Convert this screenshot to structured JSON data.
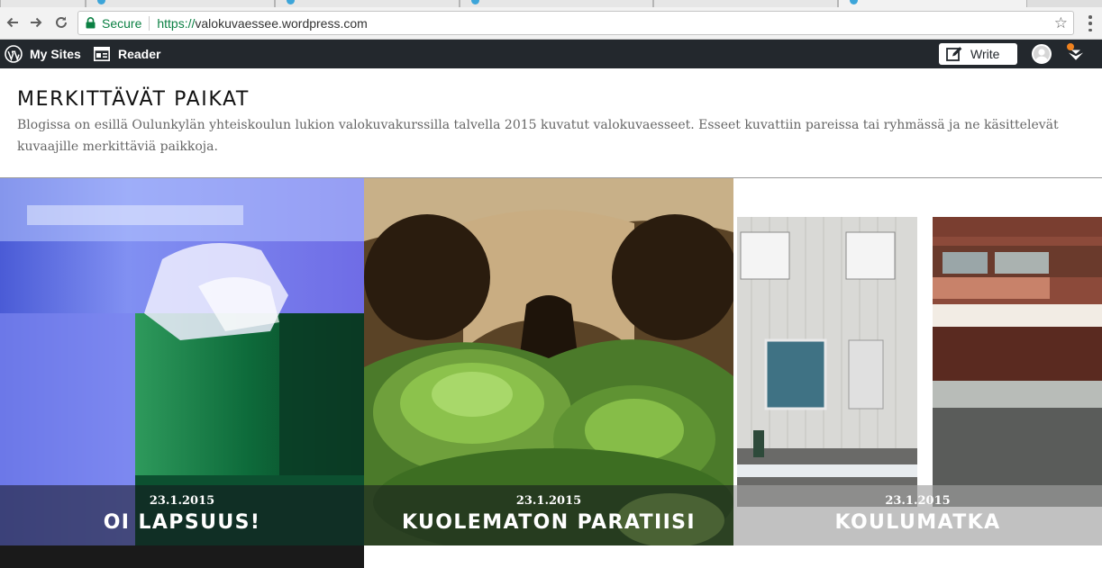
{
  "browser": {
    "secure_label": "Secure",
    "url_scheme": "https://",
    "url_host": "valokuvaessee.wordpress.com",
    "icons": [
      "back-arrow-icon",
      "forward-arrow-icon",
      "reload-icon",
      "lock-icon",
      "star-icon",
      "menu-dots-icon"
    ]
  },
  "adminbar": {
    "my_sites_label": "My Sites",
    "reader_label": "Reader",
    "write_label": "Write",
    "colors": {
      "bar": "#23282d",
      "notification": "#f0821e"
    }
  },
  "site": {
    "title": "MERKITTÄVÄT PAIKAT",
    "description": "Blogissa on esillä Oulunkylän yhteiskoulun lukion valokuvakurssilla talvella 2015 kuvatut valokuvaesseet. Esseet kuvattiin pareissa tai ryhmässä ja ne käsittelevät kuvaajille merkittäviä paikkoja."
  },
  "posts": [
    {
      "date": "23.1.2015",
      "title": "OI LAPSUUS!"
    },
    {
      "date": "23.1.2015",
      "title": "KUOLEMATON PARATIISI"
    },
    {
      "date": "23.1.2015",
      "title": "KOULUMATKA"
    }
  ]
}
